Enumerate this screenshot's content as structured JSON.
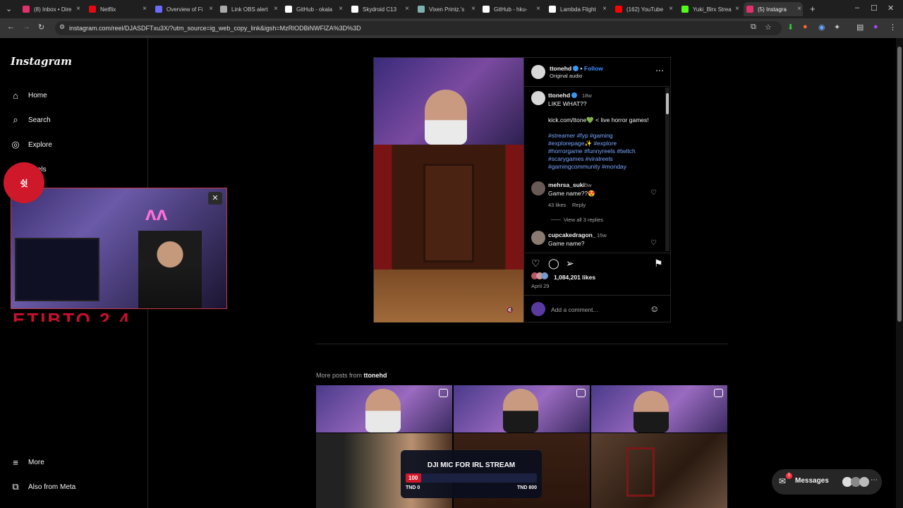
{
  "browser": {
    "tabs": [
      {
        "title": "(8) Inbox • Dire",
        "color": "#e1306c"
      },
      {
        "title": "Netflix",
        "color": "#e50914"
      },
      {
        "title": "Overview of Fi",
        "color": "#6a6aff"
      },
      {
        "title": "Link OBS alert",
        "color": "#aaaaaa"
      },
      {
        "title": "GitHub - okala",
        "color": "#ffffff"
      },
      {
        "title": "Skydroid C13",
        "color": "#ffffff"
      },
      {
        "title": "Vixen Printz.'s",
        "color": "#7fb0b0"
      },
      {
        "title": "GitHub - hku-",
        "color": "#ffffff"
      },
      {
        "title": "Lambda Flight",
        "color": "#ffffff"
      },
      {
        "title": "(162) YouTube",
        "color": "#ff0000"
      },
      {
        "title": "Yuki_Blrx Strea",
        "color": "#53fc18"
      },
      {
        "title": "(5) Instagra",
        "color": "#e1306c"
      }
    ],
    "url": "instagram.com/reel/DJASDFTxu3X/?utm_source=ig_web_copy_link&igsh=MzRlODBiNWFlZA%3D%3D"
  },
  "sidebar": {
    "logo": "Instagram",
    "items": [
      {
        "label": "Home",
        "icon": "home-icon",
        "glyph": "⌂"
      },
      {
        "label": "Search",
        "icon": "search-icon",
        "glyph": "⌕"
      },
      {
        "label": "Explore",
        "icon": "compass-icon",
        "glyph": "◎"
      },
      {
        "label": "Reels",
        "icon": "reels-icon",
        "glyph": "▣"
      }
    ],
    "bottom": [
      {
        "label": "More",
        "icon": "menu-icon",
        "glyph": "≡"
      },
      {
        "label": "Also from Meta",
        "icon": "meta-icon",
        "glyph": "⧉"
      }
    ]
  },
  "overlay": {
    "badge_text": "쉿 ",
    "red_text": "ETIBTO 2 4"
  },
  "post": {
    "author": "ttonehd",
    "follow": "Follow",
    "audio": "Original audio",
    "caption_age": "18w",
    "caption_lines": [
      "LIKE WHAT??",
      "",
      "kick.com/ttone💚 < live horror games!"
    ],
    "hashtags": [
      "#streamer #fyp #gaming",
      "#explorepage✨ #explore",
      "#horrorgame #funnyreels #twitch",
      "#scarygames #viralreels",
      "#gamingcommunity #monday"
    ],
    "comments": [
      {
        "user": "mehrsa_suki",
        "age": "5w",
        "text": "Game name??😍",
        "likes": "43 likes",
        "reply": "Reply",
        "view_replies": "View all 3 replies"
      },
      {
        "user": "cupcakedragon_",
        "age": "15w",
        "text": "Game name?"
      }
    ],
    "likes": "1,084,201 likes",
    "date": "April 29",
    "add_comment": "Add a comment..."
  },
  "more": {
    "prefix": "More posts from",
    "author": "ttonehd"
  },
  "dji": {
    "title": "DJI MIC FOR IRL STREAM",
    "current": "100",
    "progress": 0.1,
    "low": "TND 0",
    "high": "TND 800"
  },
  "messages": {
    "label": "Messages",
    "count": "5"
  }
}
